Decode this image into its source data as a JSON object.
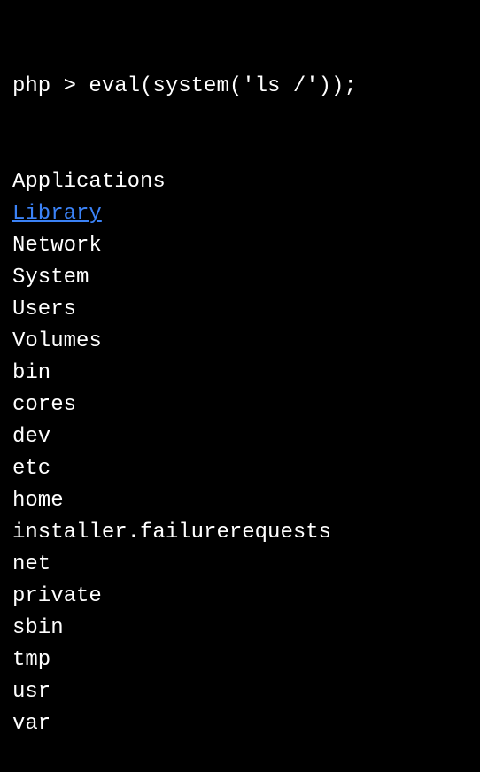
{
  "terminal": {
    "prompt": "php > eval(system('ls /'));",
    "output": [
      {
        "text": "Applications",
        "link": false
      },
      {
        "text": "Library",
        "link": true
      },
      {
        "text": "Network",
        "link": false
      },
      {
        "text": "System",
        "link": false
      },
      {
        "text": "Users",
        "link": false
      },
      {
        "text": "Volumes",
        "link": false
      },
      {
        "text": "bin",
        "link": false
      },
      {
        "text": "cores",
        "link": false
      },
      {
        "text": "dev",
        "link": false
      },
      {
        "text": "etc",
        "link": false
      },
      {
        "text": "home",
        "link": false
      },
      {
        "text": "installer.failurerequests",
        "link": false
      },
      {
        "text": "net",
        "link": false
      },
      {
        "text": "private",
        "link": false
      },
      {
        "text": "sbin",
        "link": false
      },
      {
        "text": "tmp",
        "link": false
      },
      {
        "text": "usr",
        "link": false
      },
      {
        "text": "var",
        "link": false
      }
    ]
  }
}
